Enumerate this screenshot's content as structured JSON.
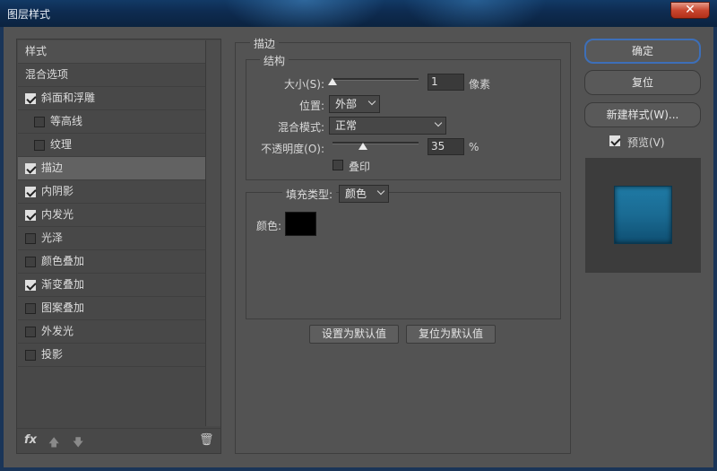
{
  "window": {
    "title": "图层样式",
    "close_glyph": "✕"
  },
  "styles_panel": {
    "header": "样式",
    "blend_options": "混合选项",
    "items": [
      {
        "label": "斜面和浮雕",
        "checked": true,
        "indent": false,
        "plus": false
      },
      {
        "label": "等高线",
        "checked": false,
        "indent": true,
        "plus": false
      },
      {
        "label": "纹理",
        "checked": false,
        "indent": true,
        "plus": false
      },
      {
        "label": "描边",
        "checked": true,
        "indent": false,
        "plus": true,
        "active": true
      },
      {
        "label": "内阴影",
        "checked": true,
        "indent": false,
        "plus": true
      },
      {
        "label": "内发光",
        "checked": true,
        "indent": false,
        "plus": false
      },
      {
        "label": "光泽",
        "checked": false,
        "indent": false,
        "plus": false
      },
      {
        "label": "颜色叠加",
        "checked": false,
        "indent": false,
        "plus": true
      },
      {
        "label": "渐变叠加",
        "checked": true,
        "indent": false,
        "plus": true
      },
      {
        "label": "图案叠加",
        "checked": false,
        "indent": false,
        "plus": false
      },
      {
        "label": "外发光",
        "checked": false,
        "indent": false,
        "plus": false
      },
      {
        "label": "投影",
        "checked": false,
        "indent": false,
        "plus": true
      }
    ],
    "tools": {
      "fx": "fx",
      "up_glyph": "🡅",
      "down_glyph": "🡇",
      "trash_glyph": "🗑"
    }
  },
  "stroke": {
    "section_title": "描边",
    "structure_title": "结构",
    "size_label": "大小(S):",
    "size_value": "1",
    "size_unit": "像素",
    "size_fraction": 0.0,
    "position_label": "位置:",
    "position_value": "外部",
    "blend_mode_label": "混合模式:",
    "blend_mode_value": "正常",
    "opacity_label": "不透明度(O):",
    "opacity_value": "35",
    "opacity_unit": "%",
    "opacity_fraction": 0.35,
    "overprint_label": "叠印",
    "overprint_checked": false,
    "fill_type_label": "填充类型:",
    "fill_type_value": "颜色",
    "color_label": "颜色:",
    "color_value": "#000000",
    "set_default": "设置为默认值",
    "reset_default": "复位为默认值"
  },
  "actions": {
    "ok": "确定",
    "reset": "复位",
    "new_style": "新建样式(W)...",
    "preview_label": "预览(V)",
    "preview_checked": true
  },
  "colors": {
    "accent": "#3d6fb8",
    "preview_fill": "#1a6b93"
  }
}
